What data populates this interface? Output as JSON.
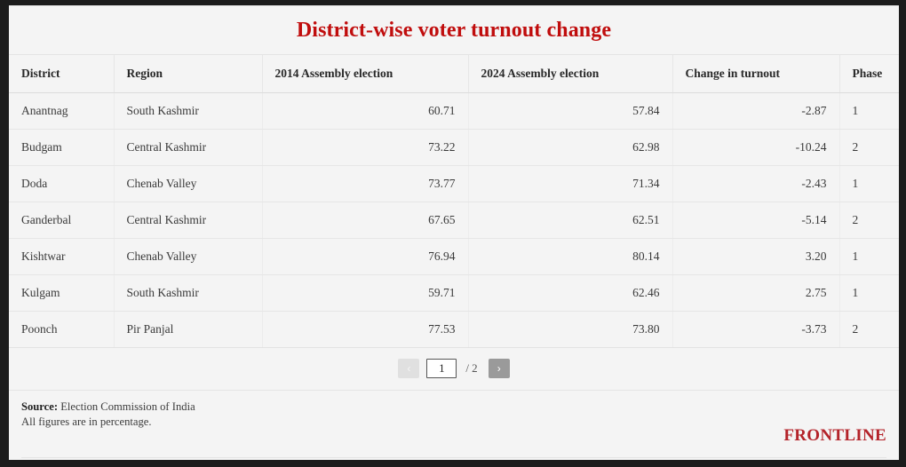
{
  "header": {
    "title": "District-wise voter turnout change"
  },
  "table": {
    "columns": [
      {
        "key": "district",
        "label": "District",
        "align": "left"
      },
      {
        "key": "region",
        "label": "Region",
        "align": "left"
      },
      {
        "key": "e2014",
        "label": "2014 Assembly election",
        "align": "right"
      },
      {
        "key": "e2024",
        "label": "2024 Assembly election",
        "align": "right"
      },
      {
        "key": "change",
        "label": "Change in turnout",
        "align": "right"
      },
      {
        "key": "phase",
        "label": "Phase",
        "align": "left"
      }
    ],
    "rows": [
      {
        "district": "Anantnag",
        "region": "South Kashmir",
        "e2014": "60.71",
        "e2024": "57.84",
        "change": "-2.87",
        "phase": "1"
      },
      {
        "district": "Budgam",
        "region": "Central Kashmir",
        "e2014": "73.22",
        "e2024": "62.98",
        "change": "-10.24",
        "phase": "2"
      },
      {
        "district": "Doda",
        "region": "Chenab Valley",
        "e2014": "73.77",
        "e2024": "71.34",
        "change": "-2.43",
        "phase": "1"
      },
      {
        "district": "Ganderbal",
        "region": "Central Kashmir",
        "e2014": "67.65",
        "e2024": "62.51",
        "change": "-5.14",
        "phase": "2"
      },
      {
        "district": "Kishtwar",
        "region": "Chenab Valley",
        "e2014": "76.94",
        "e2024": "80.14",
        "change": "3.20",
        "phase": "1"
      },
      {
        "district": "Kulgam",
        "region": "South Kashmir",
        "e2014": "59.71",
        "e2024": "62.46",
        "change": "2.75",
        "phase": "1"
      },
      {
        "district": "Poonch",
        "region": "Pir Panjal",
        "e2014": "77.53",
        "e2024": "73.80",
        "change": "-3.73",
        "phase": "2"
      }
    ]
  },
  "pagination": {
    "prev_label": "‹",
    "next_label": "›",
    "current_page": "1",
    "total_pages_label": "/ 2",
    "total_pages": "2"
  },
  "footer": {
    "source_label": "Source:",
    "source_value": " Election Commission of India",
    "note": "All figures are in percentage.",
    "logo": "FRONTLINE"
  },
  "colors": {
    "title": "#c00d0d",
    "logo": "#b4232a",
    "card_bg": "#f4f4f4",
    "frame": "#1c1c1c",
    "next_button": "#9a9a9a",
    "prev_button": "#e0e0e0"
  }
}
